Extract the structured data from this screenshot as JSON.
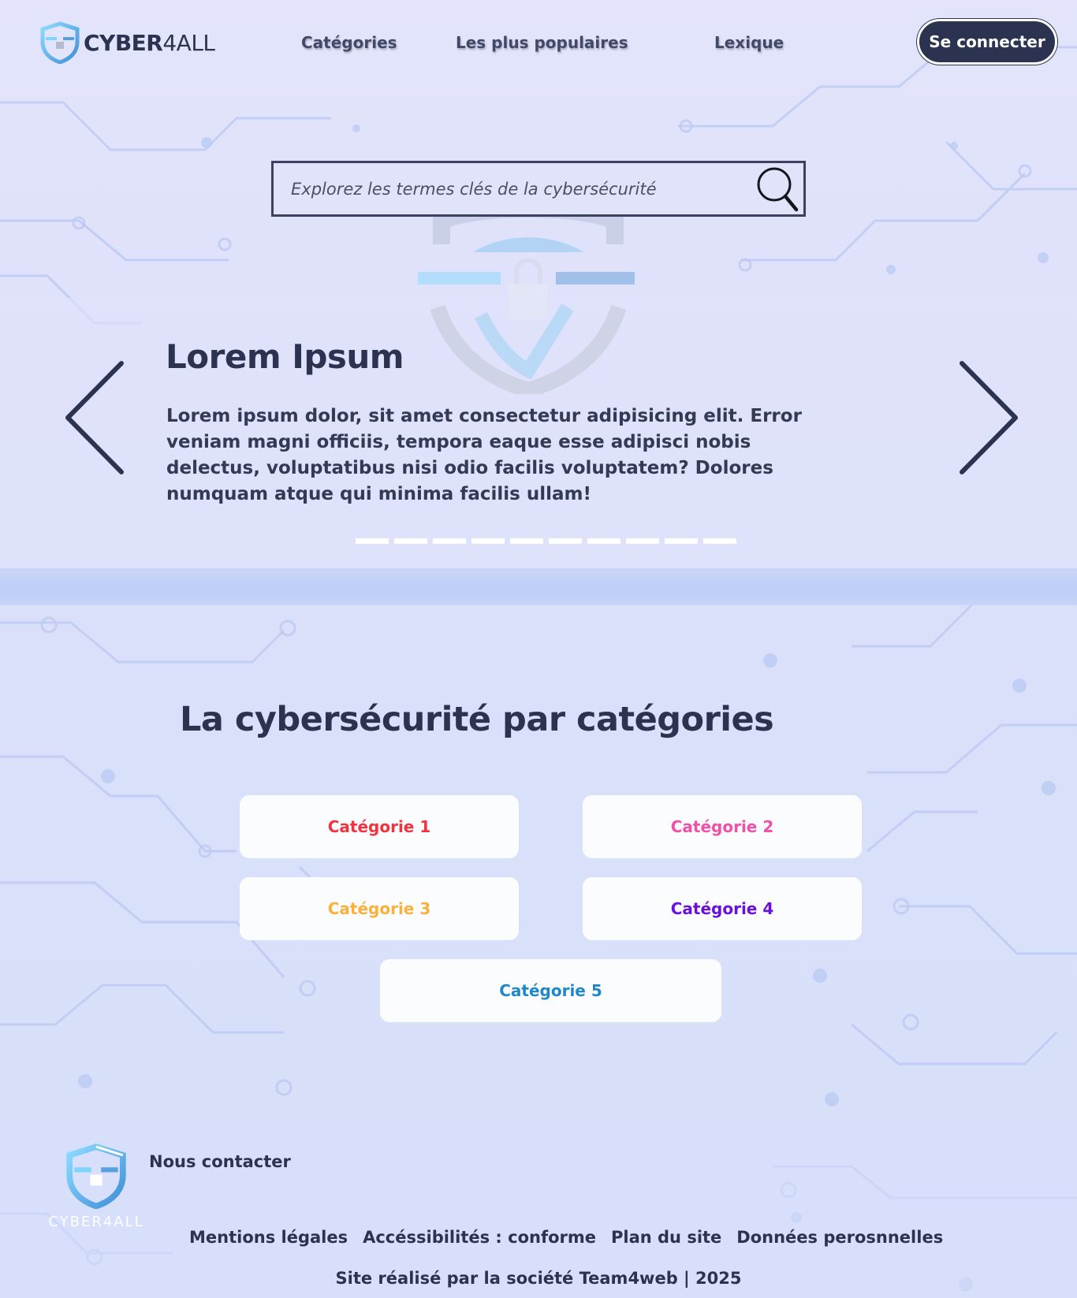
{
  "brand": {
    "logo_bold": "CYBER",
    "logo_light": "4ALL",
    "footer_logo_text": "CYBER4ALL"
  },
  "nav": {
    "items": [
      {
        "label": "Catégories"
      },
      {
        "label": "Les plus populaires"
      },
      {
        "label": "Lexique"
      }
    ],
    "login_label": "Se connecter"
  },
  "search": {
    "placeholder": "Explorez les termes clés de la cybersécurité",
    "icon": "search-icon"
  },
  "hero": {
    "title": "Lorem Ipsum",
    "text": "Lorem ipsum dolor, sit amet consectetur adipisicing elit. Error veniam magni officiis, tempora eaque esse adipisci nobis delectus, voluptatibus nisi odio facilis voluptatem? Dolores numquam atque qui minima facilis ullam!",
    "prev_icon": "chevron-left-icon",
    "next_icon": "chevron-right-icon",
    "slide_count": 10
  },
  "categories": {
    "title": "La cybersécurité par catégories",
    "items": [
      {
        "label": "Catégorie 1",
        "color": "#f2333f"
      },
      {
        "label": "Catégorie 2",
        "color": "#f050a8"
      },
      {
        "label": "Catégorie 3",
        "color": "#fbb03b"
      },
      {
        "label": "Catégorie 4",
        "color": "#6a0fe0"
      },
      {
        "label": "Catégorie 5",
        "color": "#1e88c8"
      }
    ]
  },
  "footer": {
    "contact": "Nous contacter",
    "links": [
      {
        "label": "Mentions légales"
      },
      {
        "label": "Accéssibilités : conforme"
      },
      {
        "label": "Plan du site"
      },
      {
        "label": "Données perosnnelles"
      }
    ],
    "credit": "Site réalisé par la société Team4web | 2025"
  },
  "colors": {
    "primary_dark": "#2c3350",
    "background": "#dfe3fb"
  }
}
